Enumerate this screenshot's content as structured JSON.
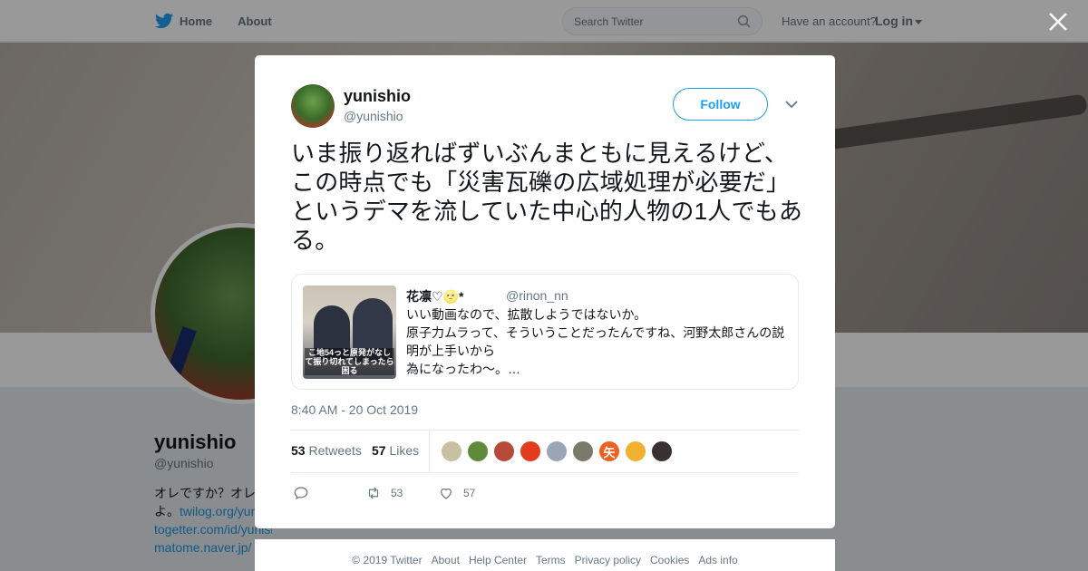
{
  "nav": {
    "home_label": "Home",
    "about_label": "About",
    "search_placeholder": "Search Twitter",
    "have_account": "Have an account?",
    "login_label": "Log in"
  },
  "profile": {
    "name": "yunishio",
    "handle": "@yunishio",
    "bio_lines": [
      "オレですか？オレ",
      "よ。twilog.org/yun",
      "togetter.com/id/yunishio",
      "matome.naver.jp/"
    ],
    "bio_prefix_line2": "よ。",
    "bio_link_line2": "twilog.org/yun"
  },
  "tweet": {
    "author_name": "yunishio",
    "author_handle": "@yunishio",
    "follow_label": "Follow",
    "text": "いま振り返ればずいぶんまともに見えるけど、この時点でも「災害瓦礫の広域処理が必要だ」というデマを流していた中心的人物の1人でもある。",
    "quote": {
      "name": "花凛♡🌝*",
      "handle": "@rinon_nn",
      "text_lines": [
        "いい動画なので、拡散しようではないか。",
        "原子力ムラって、そういうことだったんですね、河野太郎さんの説明が上手いから",
        "為になったわ〜。…"
      ],
      "image_caption": "こ地54っと原発がなして振り切れてしまったら困る"
    },
    "timestamp": "8:40 AM - 20 Oct 2019",
    "retweets_count": "53",
    "retweets_label": "Retweets",
    "likes_count": "57",
    "likes_label": "Likes",
    "reply_count": "",
    "retweet_action_count": "53",
    "like_action_count": "57",
    "liker_colors": [
      "#c8c0a0",
      "#5f8a3a",
      "#b84a3a",
      "#e33b1e",
      "#9aa6b8",
      "#7a7a6a",
      "#f06020",
      "#f0b030",
      "#3a3030"
    ],
    "liker_badge": "矢"
  },
  "footer": {
    "links": [
      "© 2019 Twitter",
      "About",
      "Help Center",
      "Terms",
      "Privacy policy",
      "Cookies",
      "Ads info"
    ]
  },
  "colors": {
    "accent": "#1da1f2",
    "muted": "#657786",
    "overlay": "rgba(0,0,0,0.40)"
  }
}
